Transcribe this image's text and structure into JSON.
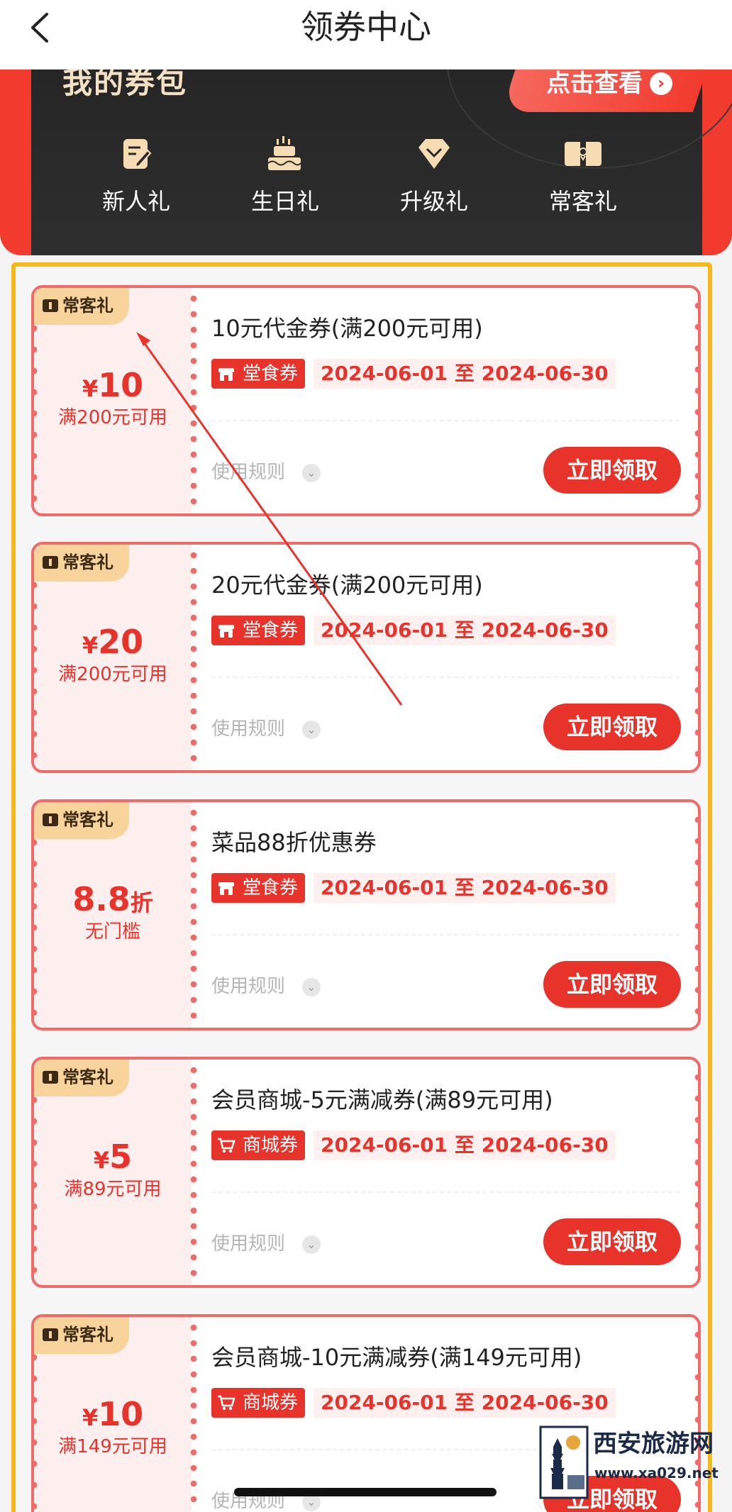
{
  "nav": {
    "title": "领券中心"
  },
  "wallet": {
    "title": "我的券包",
    "view_label": "点击查看",
    "gifts": [
      {
        "label": "新人礼",
        "icon": "note-pen-icon"
      },
      {
        "label": "生日礼",
        "icon": "cake-icon"
      },
      {
        "label": "升级礼",
        "icon": "diamond-icon"
      },
      {
        "label": "常客礼",
        "icon": "ticket-icon"
      }
    ]
  },
  "colors": {
    "accent": "#e8332a",
    "frame": "#f6b81b",
    "tag": "#f8d49c",
    "dark": "#2a2a2a"
  },
  "coupons": [
    {
      "tag": "常客礼",
      "currency": "¥",
      "amount": "10",
      "unit": "",
      "condition": "满200元可用",
      "title": "10元代金券(满200元可用)",
      "type": "堂食券",
      "type_icon": "store-icon",
      "date": "2024-06-01 至 2024-06-30",
      "rules": "使用规则",
      "claim": "立即领取"
    },
    {
      "tag": "常客礼",
      "currency": "¥",
      "amount": "20",
      "unit": "",
      "condition": "满200元可用",
      "title": "20元代金券(满200元可用)",
      "type": "堂食券",
      "type_icon": "store-icon",
      "date": "2024-06-01 至 2024-06-30",
      "rules": "使用规则",
      "claim": "立即领取"
    },
    {
      "tag": "常客礼",
      "currency": "",
      "amount": "8.8",
      "unit": "折",
      "condition": "无门槛",
      "title": "菜品88折优惠券",
      "type": "堂食券",
      "type_icon": "store-icon",
      "date": "2024-06-01 至 2024-06-30",
      "rules": "使用规则",
      "claim": "立即领取"
    },
    {
      "tag": "常客礼",
      "currency": "¥",
      "amount": "5",
      "unit": "",
      "condition": "满89元可用",
      "title": "会员商城-5元满减券(满89元可用)",
      "type": "商城券",
      "type_icon": "cart-icon",
      "date": "2024-06-01 至 2024-06-30",
      "rules": "使用规则",
      "claim": "立即领取"
    },
    {
      "tag": "常客礼",
      "currency": "¥",
      "amount": "10",
      "unit": "",
      "condition": "满149元可用",
      "title": "会员商城-10元满减券(满149元可用)",
      "type": "商城券",
      "type_icon": "cart-icon",
      "date": "2024-06-01 至 2024-06-30",
      "rules": "使用规则",
      "claim": "立即领取"
    }
  ],
  "watermark": {
    "name": "西安旅游网",
    "url": "www.xa029.net"
  }
}
